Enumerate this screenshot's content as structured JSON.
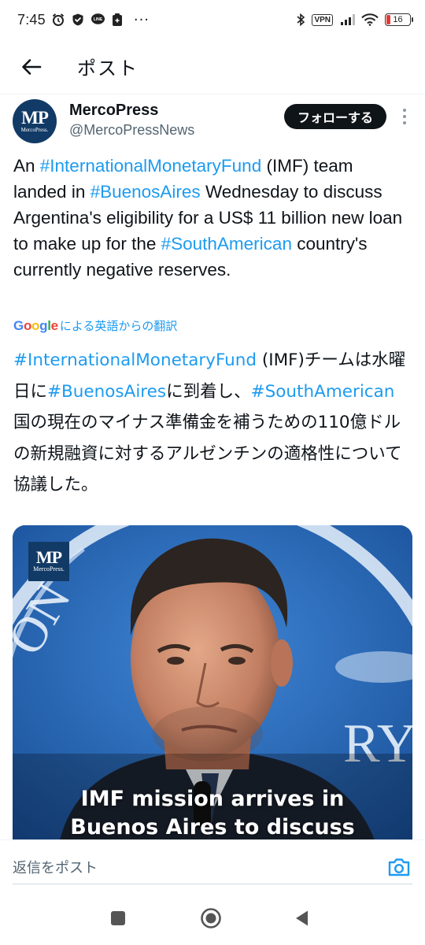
{
  "status_bar": {
    "time": "7:45",
    "vpn": "VPN",
    "battery": "16",
    "more": "···"
  },
  "header": {
    "title": "ポスト"
  },
  "tweet": {
    "author_name": "MercoPress",
    "author_handle": "@MercoPressNews",
    "avatar_text": "MP",
    "avatar_subtext": "MercoPress.",
    "follow_label": "フォローする",
    "body": [
      {
        "text": "An ",
        "tag": false
      },
      {
        "text": "#InternationalMonetaryFund",
        "tag": true
      },
      {
        "text": " (IMF) team landed in ",
        "tag": false
      },
      {
        "text": "#BuenosAires",
        "tag": true
      },
      {
        "text": " Wednesday to discuss Argentina's eligibility for a US$ 11 billion new loan to make up for the ",
        "tag": false
      },
      {
        "text": "#SouthAmerican",
        "tag": true
      },
      {
        "text": " country's currently negative reserves.",
        "tag": false
      }
    ],
    "translate_logo": "Google",
    "translate_label": "による英語からの翻訳",
    "translated_body": [
      {
        "text": "#InternationalMonetaryFund",
        "tag": true
      },
      {
        "text": " (IMF)チームは水曜日に",
        "tag": false
      },
      {
        "text": "#BuenosAires",
        "tag": true
      },
      {
        "text": "に到着し、",
        "tag": false
      },
      {
        "text": "#SouthAmerican",
        "tag": true
      },
      {
        "text": "国の現在のマイナス準備金を補うための110億ドルの新規融資に対するアルゼンチンの適格性について協議した。",
        "tag": false
      }
    ],
    "media": {
      "logo_text": "MP",
      "logo_subtext": "MercoPress.",
      "caption_line1": "IMF mission arrives in",
      "caption_line2": "Buenos Aires to discuss"
    }
  },
  "reply": {
    "placeholder": "返信をポスト"
  },
  "colors": {
    "accent": "#1d9bf0",
    "text": "#0f1419",
    "secondary": "#536471",
    "follow_bg": "#0f1419",
    "avatar_bg": "#123a66"
  }
}
